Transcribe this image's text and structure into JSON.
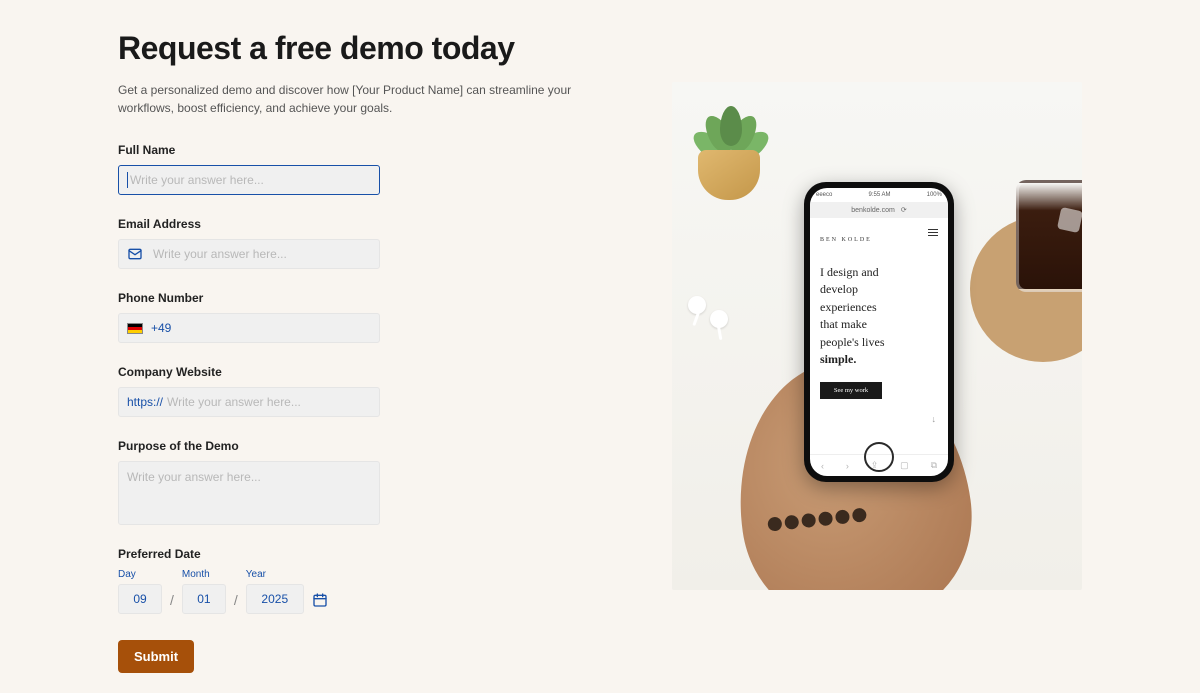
{
  "header": {
    "title": "Request a free demo today",
    "subtitle": "Get a personalized demo and discover how [Your Product Name] can streamline your workflows, boost efficiency, and achieve your goals."
  },
  "form": {
    "full_name": {
      "label": "Full Name",
      "placeholder": "Write your answer here...",
      "value": ""
    },
    "email": {
      "label": "Email Address",
      "placeholder": "Write your answer here...",
      "value": ""
    },
    "phone": {
      "label": "Phone Number",
      "country_flag": "de",
      "prefix": "+49",
      "value": ""
    },
    "website": {
      "label": "Company Website",
      "protocol": "https://",
      "placeholder": "Write your answer here...",
      "value": ""
    },
    "purpose": {
      "label": "Purpose of the Demo",
      "placeholder": "Write your answer here...",
      "value": ""
    },
    "preferred_date": {
      "label": "Preferred Date",
      "day_label": "Day",
      "month_label": "Month",
      "year_label": "Year",
      "day": "09",
      "month": "01",
      "year": "2025"
    },
    "submit_label": "Submit"
  },
  "hero": {
    "phone": {
      "status_time": "9:55 AM",
      "status_left": "eeeco",
      "status_right": "100%",
      "url": "benkolde.com",
      "brand": "BEN KOLDE",
      "copy_lines": [
        "I design and",
        "develop",
        "experiences",
        "that make",
        "people's lives"
      ],
      "copy_bold": "simple.",
      "cta": "See my work"
    }
  }
}
